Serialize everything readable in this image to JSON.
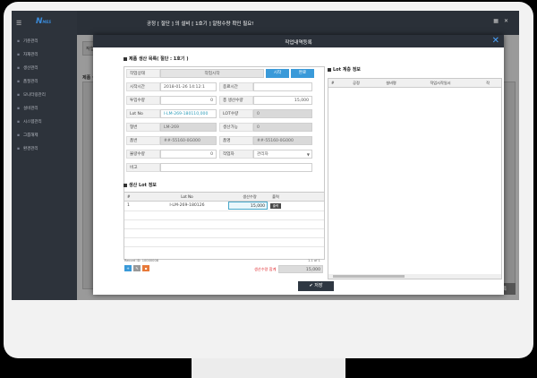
{
  "app": {
    "logo": "N",
    "logo_small": "MES",
    "top_title": "공정 [ 절단 ] 의 설비 [ 1호기 ] 알람수량 확인 필요!",
    "sidebar": [
      "기준관리",
      "자재관리",
      "생산관리",
      "품질관리",
      "모니터링관리",
      "설비관리",
      "시스템관리",
      "그룹해제",
      "환경관리"
    ]
  },
  "background": {
    "filter_label": "작업일",
    "panel_title": "제품 생산",
    "bottom_button": "작업 등록"
  },
  "modal": {
    "title": "작업내역등록",
    "section_product": "제품 생산 목록( 절단 : 1호기 )",
    "form": {
      "status_label": "작업상태",
      "status_value": "작업시작",
      "start_button": "시작",
      "complete_button": "완료",
      "start_time_label": "시작시간",
      "start_time_value": "2018-01-26 14:12:1",
      "end_time_label": "종료시간",
      "end_time_value": "",
      "input_qty_label": "투입수량",
      "input_qty_value": "0",
      "total_qty_label": "총 생산수량",
      "total_qty_value": "15,000",
      "lotno_label": "Lot No",
      "lotno_value": "I-LM-269-180110,000",
      "lot_qty_label": "LOT수량",
      "lot_qty_value": "0",
      "model_label": "형번",
      "model_value": "LM-269",
      "producible_label": "생산가능",
      "producible_value": "0",
      "item_label": "품번",
      "item_value": "##-55160-0G000",
      "item2_label": "품명",
      "item2_value": "##-55160-0G000",
      "defect_label": "불량수량",
      "defect_value": "0",
      "worker_label": "작업자",
      "worker_value": "관리자",
      "note_label": "비고",
      "note_value": ""
    },
    "section_lot": "생산 Lot 정보",
    "lot_table": {
      "headers": [
        "#",
        "Lot No",
        "생산수량",
        "출력"
      ],
      "rows": [
        {
          "no": "1",
          "lot": "I-LM-269-180126",
          "qty": "15,000",
          "print": "출력"
        }
      ],
      "record_id": "Record ID: 10000008",
      "paging": "1-1 of 1"
    },
    "warn_label": "생산수량 합계",
    "warn_total": "15,000",
    "save_button": "저장",
    "section_right": "Lot 계층 정보",
    "right_table": {
      "headers": [
        "#",
        "공정",
        "설비명",
        "작업시작일시",
        "작"
      ]
    }
  },
  "colors": {
    "accent": "#3a9ad9",
    "header": "#2b313a",
    "warn": "#e0262b"
  }
}
